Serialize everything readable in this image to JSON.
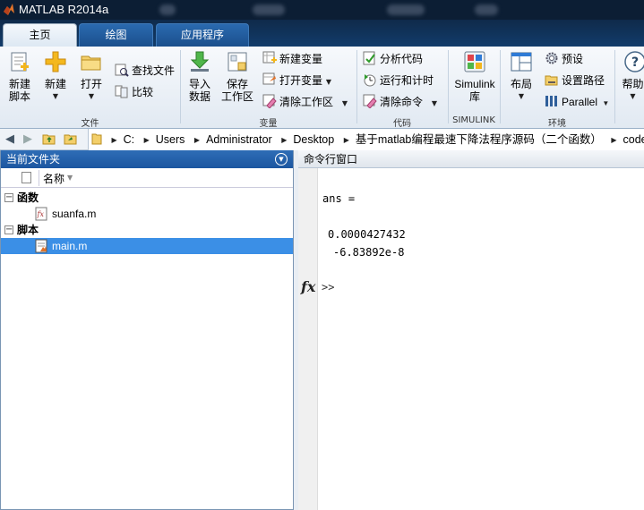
{
  "window": {
    "title": "MATLAB R2014a"
  },
  "tabs": [
    {
      "label": "主页",
      "active": true
    },
    {
      "label": "绘图",
      "active": false
    },
    {
      "label": "应用程序",
      "active": false
    }
  ],
  "ribbon": {
    "file": {
      "label": "文件",
      "new_script": "新建\n脚本",
      "new": "新建",
      "open": "打开",
      "find_files": "查找文件",
      "compare": "比较"
    },
    "variable": {
      "label": "变量",
      "import": "导入\n数据",
      "save_workspace": "保存\n工作区",
      "new_variable": "新建变量",
      "open_variable": "打开变量",
      "clear_workspace": "清除工作区"
    },
    "code": {
      "label": "代码",
      "analyze": "分析代码",
      "run_time": "运行和计时",
      "clear_commands": "清除命令"
    },
    "simulink": {
      "label": "SIMULINK",
      "library": "Simulink\n库"
    },
    "environment": {
      "label": "环境",
      "layout": "布局",
      "preferences": "预设",
      "set_path": "设置路径",
      "parallel": "Parallel"
    },
    "help": "帮助"
  },
  "address": {
    "crumbs": [
      "C:",
      "Users",
      "Administrator",
      "Desktop",
      "基于matlab编程最速下降法程序源码（二个函数）",
      "code"
    ]
  },
  "folder_panel": {
    "title": "当前文件夹",
    "column_name": "名称",
    "groups": [
      {
        "label": "函数",
        "files": [
          "suanfa.m"
        ]
      },
      {
        "label": "脚本",
        "files": [
          "main.m"
        ]
      }
    ]
  },
  "command_window": {
    "title": "命令行窗口",
    "lines": [
      "ans =",
      "0.0000427432",
      "-6.83892e-8"
    ],
    "fx": "fx",
    "prompt": ">>"
  },
  "colors": {
    "titlebar": "#0c1e34",
    "selected_row": "#3b8fe6",
    "panel_header": "#1c56a0"
  }
}
